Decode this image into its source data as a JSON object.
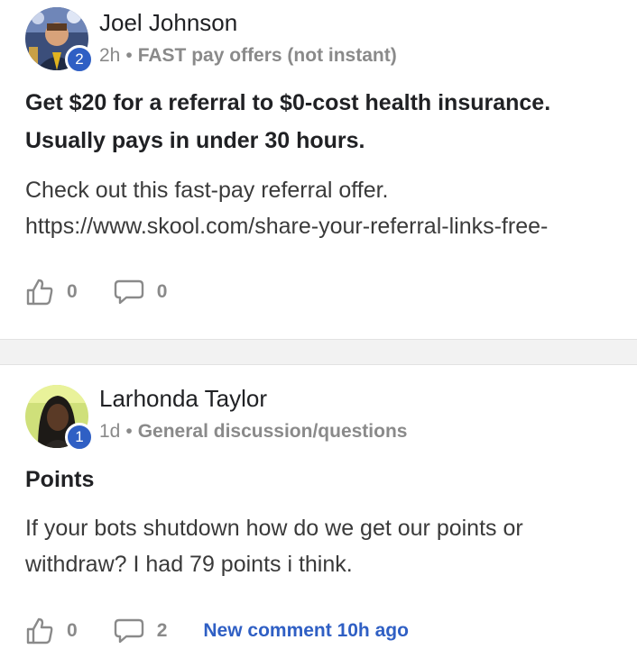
{
  "posts": [
    {
      "author": "Joel Johnson",
      "level": "2",
      "time": "2h",
      "separator": "•",
      "category": "FAST pay offers (not instant)",
      "title_lines": [
        "Get $20 for a referral to $0-cost health insurance.",
        "Usually pays in under 30 hours."
      ],
      "body_lines": [
        "Check out this fast-pay referral offer.",
        "https://www.skool.com/share-your-referral-links-free-"
      ],
      "likes": "0",
      "comments": "0",
      "avatar_icon": "avatar-photo"
    },
    {
      "author": "Larhonda Taylor",
      "level": "1",
      "time": "1d",
      "separator": "•",
      "category": "General discussion/questions",
      "title_lines": [
        "Points"
      ],
      "body_lines": [
        "If your bots shutdown how do we get our points or",
        "withdraw? I had 79 points i think."
      ],
      "likes": "0",
      "comments": "2",
      "new_comment": "New comment 10h ago",
      "avatar_icon": "avatar-photo"
    }
  ],
  "colors": {
    "badge": "#2f5fc4",
    "link": "#2f5fc4",
    "meta": "#8a8a8a",
    "divider": "#f2f2f2"
  },
  "icons": {
    "like": "thumbs-up-icon",
    "comment": "comment-bubble-icon"
  }
}
